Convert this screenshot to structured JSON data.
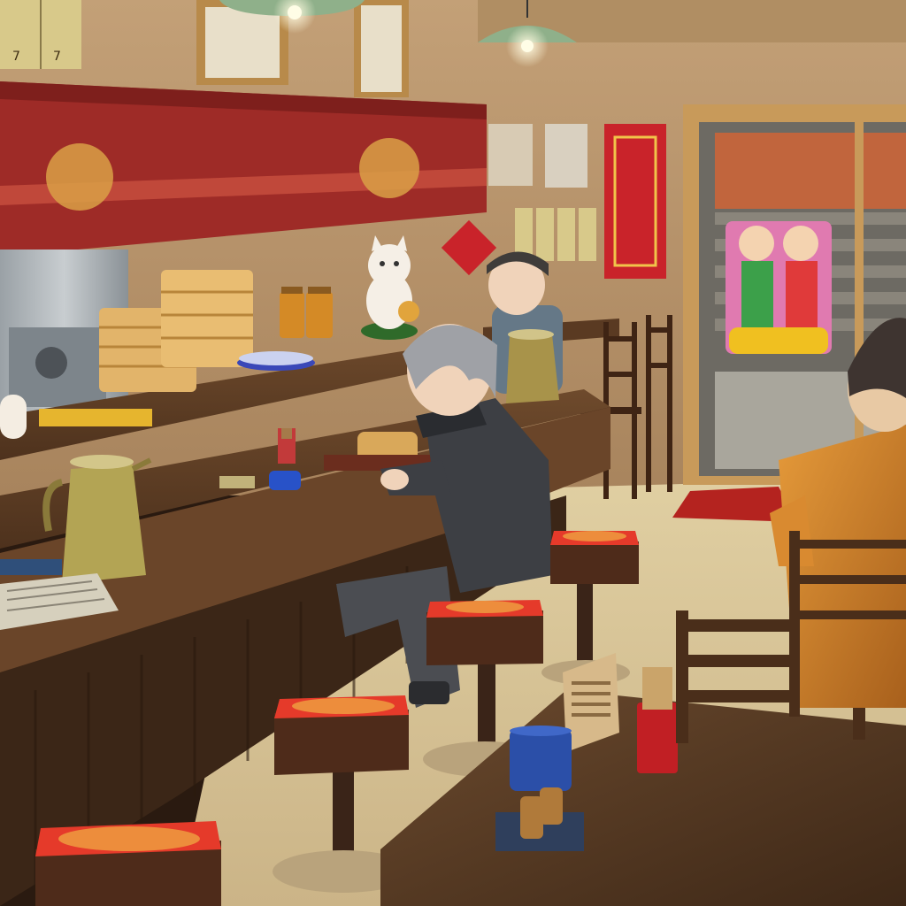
{
  "scene": {
    "type": "3d-game-screenshot",
    "setting": "chinese-restaurant-interior",
    "hud_present": false
  },
  "signs": {
    "menu_tag_1": "7",
    "menu_tag_2": "7"
  },
  "colors": {
    "wall": "#c9a57a",
    "wall_shadow": "#9c7a55",
    "counter_wood": "#5a3a22",
    "counter_front": "#3b2617",
    "floor": "#d9c79a",
    "banner_red": "#b0302a",
    "stool_seat": "#e53a2a",
    "door_frame": "#c89a5a",
    "lamp_green": "#8fb08a"
  },
  "icons": [
    "lucky-cat-figure",
    "steamer-basket-stack",
    "teapot",
    "lamp"
  ]
}
